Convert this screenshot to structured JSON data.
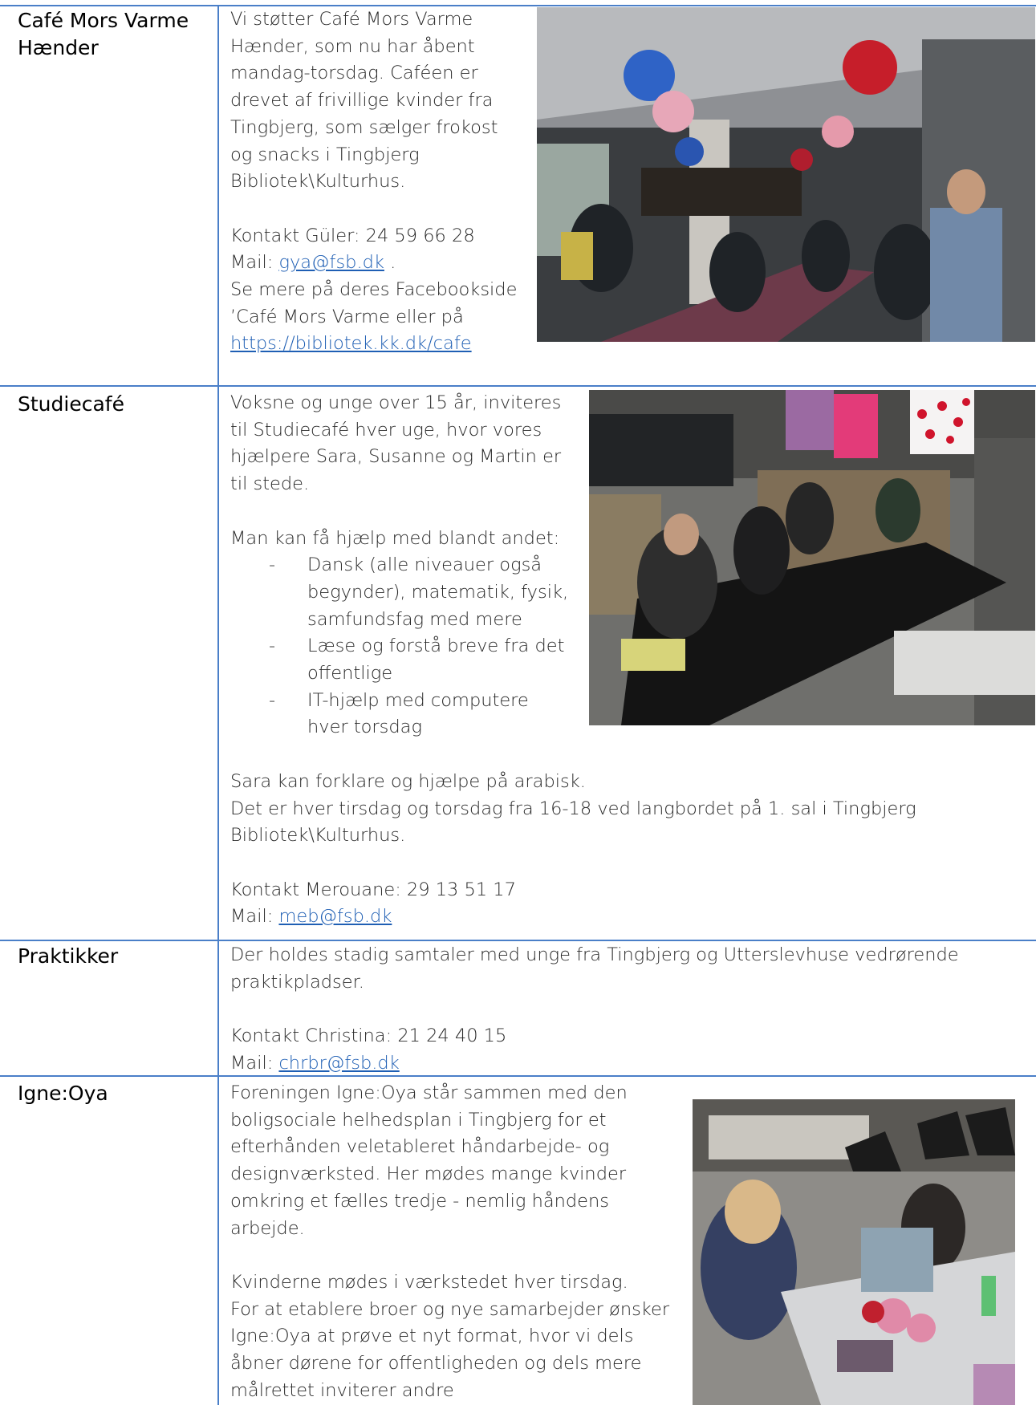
{
  "rows": [
    {
      "label": "Café Mors Varme Hænder",
      "lines": [
        "Vi støtter Café Mors Varme",
        "Hænder, som nu har åbent",
        "mandag-torsdag. Caféen er",
        "drevet af frivillige kvinder fra",
        "Tingbjerg, som sælger frokost",
        "og snacks i Tingbjerg",
        "Bibliotek\\Kulturhus."
      ],
      "contact": "Kontakt Güler: 24 59 66 28",
      "mail_prefix": "Mail: ",
      "mail": "gya@fsb.dk",
      "mail_suffix": " .",
      "see_more_1": "Se mere på deres Facebookside",
      "see_more_2": "’Café Mors Varme eller på",
      "url": "https://bibliotek.kk.dk/cafe"
    },
    {
      "label": "Studiecafé",
      "lines": [
        "Voksne og unge over 15 år, inviteres",
        "til Studiecafé hver uge, hvor vores",
        "hjælpere Sara, Susanne og Martin er",
        "til stede."
      ],
      "help_intro": "Man kan få hjælp med blandt andet:",
      "list": [
        [
          "Dansk (alle niveauer også",
          "begynder), matematik, fysik,",
          "samfundsfag med mere"
        ],
        [
          "Læse og forstå breve fra det",
          "offentlige"
        ],
        [
          "IT-hjælp med computere",
          "hver torsdag"
        ]
      ],
      "after_1": "Sara kan forklare og hjælpe på arabisk.",
      "after_2": "Det er hver tirsdag og torsdag fra 16-18 ved langbordet på 1. sal i Tingbjerg",
      "after_3": "Bibliotek\\Kulturhus.",
      "contact": "Kontakt Merouane: 29 13 51 17",
      "mail_prefix": "Mail: ",
      "mail": "meb@fsb.dk"
    },
    {
      "label": "Praktikker",
      "line_1": "Der holdes stadig samtaler med unge fra Tingbjerg og Utterslevhuse vedrørende",
      "line_2": "praktikpladser.",
      "contact": "Kontakt Christina: 21 24 40 15",
      "mail_prefix": "Mail: ",
      "mail": "chrbr@fsb.dk"
    },
    {
      "label": "Igne:Oya",
      "lines": [
        "Foreningen Igne:Oya står sammen med den",
        "boligsociale helhedsplan i Tingbjerg for et",
        "efterhånden veletableret håndarbejde- og",
        "designværksted. Her mødes mange kvinder",
        "omkring et fælles tredje - nemlig håndens",
        "arbejde."
      ],
      "lines_2": [
        "Kvinderne mødes i værkstedet hver tirsdag.",
        "For at etablere broer og nye samarbejder ønsker",
        "Igne:Oya at prøve et nyt format, hvor vi dels",
        "åbner dørene for offentligheden og dels mere",
        "målrettet inviterer andre"
      ]
    }
  ],
  "list_dash": "-"
}
